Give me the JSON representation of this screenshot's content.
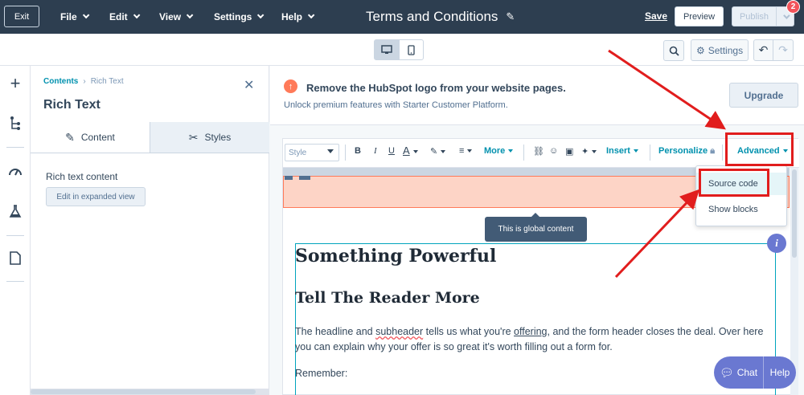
{
  "topbar": {
    "exit_label": "Exit",
    "menus": [
      "File",
      "Edit",
      "View",
      "Settings",
      "Help"
    ],
    "page_title": "Terms and Conditions",
    "save_label": "Save",
    "preview_label": "Preview",
    "publish_label": "Publish",
    "notification_count": "2"
  },
  "subbar": {
    "settings_label": "Settings"
  },
  "panel": {
    "breadcrumb_root": "Contents",
    "breadcrumb_separator": "›",
    "breadcrumb_current": "Rich Text",
    "title": "Rich Text",
    "tabs": [
      {
        "label": "Content"
      },
      {
        "label": "Styles"
      }
    ],
    "field_label": "Rich text content",
    "expand_button": "Edit in expanded view"
  },
  "banner": {
    "title": "Remove the HubSpot logo from your website pages.",
    "text": "Unlock premium features with Starter Customer Platform.",
    "upgrade_label": "Upgrade"
  },
  "toolbar": {
    "style_placeholder": "Style",
    "bold": "B",
    "italic": "I",
    "underline": "U",
    "text_color": "A",
    "more": "More",
    "insert": "Insert",
    "personalize": "Personalize",
    "advanced": "Advanced"
  },
  "dropdown": {
    "items": [
      "Source code",
      "Show blocks"
    ]
  },
  "canvas": {
    "tooltip": "This is global content",
    "h1": "Something Powerful",
    "h2": "Tell The Reader More",
    "para_1": "The headline and ",
    "para_misspelled": "subheader",
    "para_2": " tells us what you're ",
    "para_link": "offering",
    "para_3": ", and the form header closes the deal. Over here you can explain why your offer is so great it's worth filling out a form for.",
    "remember": "Remember:"
  },
  "chat": {
    "chat_label": "Chat",
    "help_label": "Help"
  },
  "colors": {
    "topbar": "#2d3e50",
    "accent_teal": "#0091ae",
    "annotation_red": "#e11d1d",
    "chat_purple": "#6a78d1",
    "global_block": "#fdd4c6"
  },
  "icons": [
    "pencil-icon",
    "desktop-icon",
    "mobile-icon",
    "search-icon",
    "gear-icon",
    "undo-icon",
    "redo-icon",
    "plus-icon",
    "tree-icon",
    "gauge-icon",
    "flask-icon",
    "page-icon",
    "close-icon",
    "warning-icon",
    "info-icon",
    "chat-bubble-icon"
  ]
}
